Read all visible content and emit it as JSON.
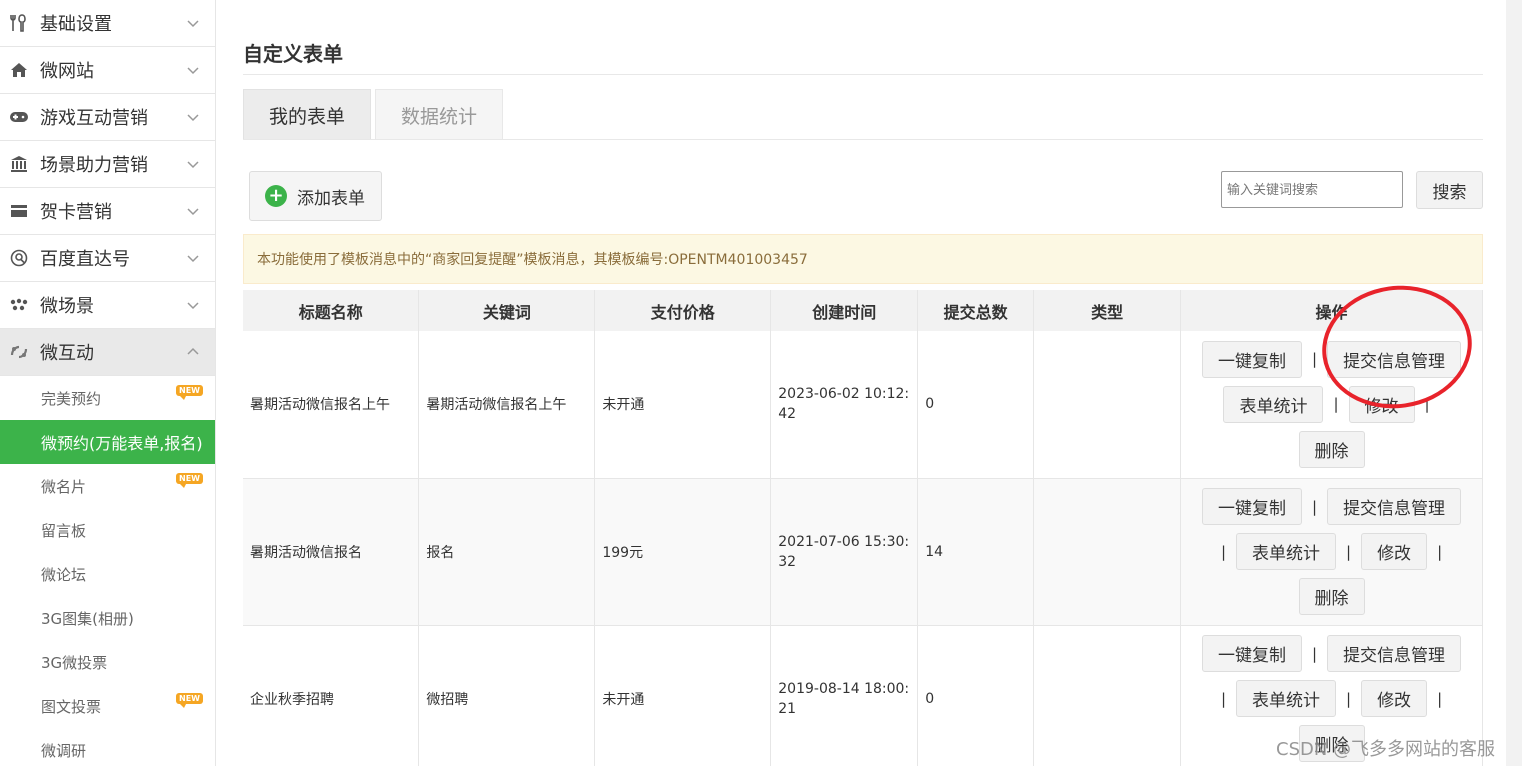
{
  "sidebar": {
    "items": [
      {
        "label": "基础设置",
        "icon": "tools-icon"
      },
      {
        "label": "微网站",
        "icon": "home-icon"
      },
      {
        "label": "游戏互动营销",
        "icon": "gamepad-icon"
      },
      {
        "label": "场景助力营销",
        "icon": "bank-icon"
      },
      {
        "label": "贺卡营销",
        "icon": "card-icon"
      },
      {
        "label": "百度直达号",
        "icon": "baidu-icon"
      },
      {
        "label": "微场景",
        "icon": "dots-icon"
      },
      {
        "label": "微互动",
        "icon": "interaction-icon"
      }
    ],
    "sub_items": [
      {
        "label": "完美预约",
        "badge": "NEW"
      },
      {
        "label": "微预约(万能表单,报名)",
        "badge": ""
      },
      {
        "label": "微名片",
        "badge": "NEW"
      },
      {
        "label": "留言板",
        "badge": ""
      },
      {
        "label": "微论坛",
        "badge": ""
      },
      {
        "label": "3G图集(相册)",
        "badge": ""
      },
      {
        "label": "3G微投票",
        "badge": ""
      },
      {
        "label": "图文投票",
        "badge": "NEW"
      },
      {
        "label": "微调研",
        "badge": ""
      }
    ]
  },
  "main": {
    "title": "自定义表单",
    "tabs": [
      {
        "label": "我的表单"
      },
      {
        "label": "数据统计"
      }
    ],
    "add_button": "添加表单",
    "search": {
      "placeholder": "输入关键词搜索",
      "button": "搜索"
    },
    "notice": "本功能使用了模板消息中的“商家回复提醒”模板消息，其模板编号:OPENTM401003457"
  },
  "table": {
    "headers": [
      "标题名称",
      "关键词",
      "支付价格",
      "创建时间",
      "提交总数",
      "类型",
      "操作"
    ],
    "rows": [
      {
        "title": "暑期活动微信报名上午",
        "keyword": "暑期活动微信报名上午",
        "price": "未开通",
        "created": "2023-06-02 10:12:42",
        "total": "0",
        "type": ""
      },
      {
        "title": "暑期活动微信报名",
        "keyword": "报名",
        "price": "199元",
        "created": "2021-07-06 15:30:32",
        "total": "14",
        "type": ""
      },
      {
        "title": "企业秋季招聘",
        "keyword": "微招聘",
        "price": "未开通",
        "created": "2019-08-14 18:00:21",
        "total": "0",
        "type": ""
      }
    ],
    "actions": {
      "copy": "一键复制",
      "manage": "提交信息管理",
      "stats": "表单统计",
      "edit": "修改",
      "delete": "删除",
      "sep": "|"
    }
  },
  "watermark": "CSDN @飞多多网站的客服",
  "colors": {
    "accent_green": "#3cb34a",
    "highlight_red": "#e8232b",
    "notice_bg": "#fcf8e3",
    "notice_text": "#8a6d3b",
    "badge_orange": "#f5a623"
  }
}
